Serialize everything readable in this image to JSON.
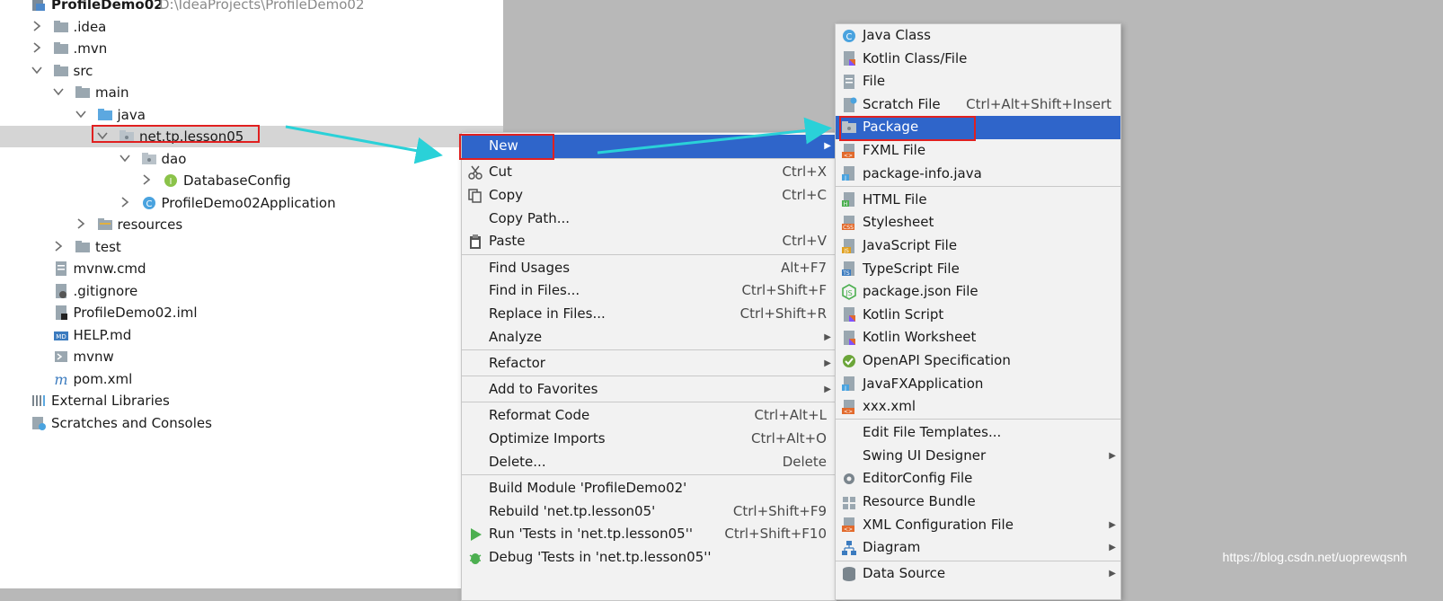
{
  "tree": {
    "rows": [
      {
        "label": "ProfileDemo02",
        "hint": "D:\\IdeaProjects\\ProfileDemo02",
        "bold": true,
        "indent": 0,
        "icon": "module-icon",
        "chev": "none"
      },
      {
        "label": ".idea",
        "indent": 1,
        "icon": "folder-icon",
        "chev": "right"
      },
      {
        "label": ".mvn",
        "indent": 1,
        "icon": "folder-icon",
        "chev": "right"
      },
      {
        "label": "src",
        "indent": 1,
        "icon": "folder-icon",
        "chev": "down"
      },
      {
        "label": "main",
        "indent": 2,
        "icon": "folder-icon",
        "chev": "down"
      },
      {
        "label": "java",
        "indent": 3,
        "icon": "source-folder-icon",
        "chev": "down"
      },
      {
        "label": "net.tp.lesson05",
        "indent": 4,
        "icon": "package-icon",
        "chev": "down",
        "selected": true
      },
      {
        "label": "dao",
        "indent": 5,
        "icon": "package-icon",
        "chev": "down"
      },
      {
        "label": "DatabaseConfig",
        "indent": 6,
        "icon": "interface-icon",
        "chev": "right"
      },
      {
        "label": "ProfileDemo02Application",
        "indent": 5,
        "icon": "spring-class-icon",
        "chev": "right"
      },
      {
        "label": "resources",
        "indent": 3,
        "icon": "resources-folder-icon",
        "chev": "right"
      },
      {
        "label": "test",
        "indent": 2,
        "icon": "folder-icon",
        "chev": "right"
      },
      {
        "label": "mvnw.cmd",
        "indent": 1,
        "icon": "text-file-icon",
        "chev": "none"
      },
      {
        "label": ".gitignore",
        "indent": 1,
        "icon": "ignore-file-icon",
        "chev": "none"
      },
      {
        "label": "ProfileDemo02.iml",
        "indent": 1,
        "icon": "iml-file-icon",
        "chev": "none"
      },
      {
        "label": "HELP.md",
        "indent": 1,
        "icon": "markdown-icon",
        "chev": "none"
      },
      {
        "label": "mvnw",
        "indent": 1,
        "icon": "shell-script-icon",
        "chev": "none"
      },
      {
        "label": "pom.xml",
        "indent": 1,
        "icon": "maven-icon",
        "chev": "none"
      },
      {
        "label": "External Libraries",
        "indent": 0,
        "icon": "libraries-icon",
        "chev": "none"
      },
      {
        "label": "Scratches and Consoles",
        "indent": 0,
        "icon": "scratches-icon",
        "chev": "none"
      }
    ]
  },
  "context_menu": {
    "items": [
      {
        "label": "New",
        "shortcut": "",
        "submenu": true,
        "highlighted": true,
        "icon": ""
      },
      {
        "sep": true
      },
      {
        "label": "Cut",
        "shortcut": "Ctrl+X",
        "icon": "cut-icon"
      },
      {
        "label": "Copy",
        "shortcut": "Ctrl+C",
        "icon": "copy-icon"
      },
      {
        "label": "Copy Path...",
        "shortcut": "",
        "icon": ""
      },
      {
        "label": "Paste",
        "shortcut": "Ctrl+V",
        "icon": "paste-icon"
      },
      {
        "sep": true
      },
      {
        "label": "Find Usages",
        "shortcut": "Alt+F7",
        "icon": ""
      },
      {
        "label": "Find in Files...",
        "shortcut": "Ctrl+Shift+F",
        "icon": ""
      },
      {
        "label": "Replace in Files...",
        "shortcut": "Ctrl+Shift+R",
        "icon": ""
      },
      {
        "label": "Analyze",
        "shortcut": "",
        "submenu": true,
        "icon": ""
      },
      {
        "sep": true
      },
      {
        "label": "Refactor",
        "shortcut": "",
        "submenu": true,
        "icon": ""
      },
      {
        "sep": true
      },
      {
        "label": "Add to Favorites",
        "shortcut": "",
        "submenu": true,
        "icon": ""
      },
      {
        "sep": true
      },
      {
        "label": "Reformat Code",
        "shortcut": "Ctrl+Alt+L",
        "icon": ""
      },
      {
        "label": "Optimize Imports",
        "shortcut": "Ctrl+Alt+O",
        "icon": ""
      },
      {
        "label": "Delete...",
        "shortcut": "Delete",
        "icon": ""
      },
      {
        "sep": true
      },
      {
        "label": "Build Module 'ProfileDemo02'",
        "shortcut": "",
        "icon": ""
      },
      {
        "label": "Rebuild 'net.tp.lesson05'",
        "shortcut": "Ctrl+Shift+F9",
        "icon": ""
      },
      {
        "label": "Run 'Tests in 'net.tp.lesson05''",
        "shortcut": "Ctrl+Shift+F10",
        "icon": "run-icon"
      },
      {
        "label": "Debug 'Tests in 'net.tp.lesson05''",
        "shortcut": "",
        "icon": "debug-icon"
      }
    ]
  },
  "new_submenu": {
    "items": [
      {
        "label": "Java Class",
        "shortcut": "",
        "icon": "java-class-icon"
      },
      {
        "label": "Kotlin Class/File",
        "shortcut": "",
        "icon": "kotlin-file-icon"
      },
      {
        "label": "File",
        "shortcut": "",
        "icon": "file-icon"
      },
      {
        "label": "Scratch File",
        "shortcut": "Ctrl+Alt+Shift+Insert",
        "icon": "scratch-file-icon"
      },
      {
        "label": "Package",
        "shortcut": "",
        "icon": "package-icon",
        "highlighted": true
      },
      {
        "label": "FXML File",
        "shortcut": "",
        "icon": "fxml-file-icon"
      },
      {
        "label": "package-info.java",
        "shortcut": "",
        "icon": "java-file-icon"
      },
      {
        "sep": true
      },
      {
        "label": "HTML File",
        "shortcut": "",
        "icon": "html-file-icon"
      },
      {
        "label": "Stylesheet",
        "shortcut": "",
        "icon": "css-file-icon"
      },
      {
        "label": "JavaScript File",
        "shortcut": "",
        "icon": "js-file-icon"
      },
      {
        "label": "TypeScript File",
        "shortcut": "",
        "icon": "ts-file-icon"
      },
      {
        "label": "package.json File",
        "shortcut": "",
        "icon": "nodejs-icon"
      },
      {
        "label": "Kotlin Script",
        "shortcut": "",
        "icon": "kotlin-file-icon"
      },
      {
        "label": "Kotlin Worksheet",
        "shortcut": "",
        "icon": "kotlin-file-icon"
      },
      {
        "label": "OpenAPI Specification",
        "shortcut": "",
        "icon": "openapi-icon"
      },
      {
        "label": "JavaFXApplication",
        "shortcut": "",
        "icon": "java-file-icon"
      },
      {
        "label": "xxx.xml",
        "shortcut": "",
        "icon": "xml-file-icon"
      },
      {
        "sep": true
      },
      {
        "label": "Edit File Templates...",
        "shortcut": "",
        "icon": ""
      },
      {
        "label": "Swing UI Designer",
        "shortcut": "",
        "submenu": true,
        "icon": ""
      },
      {
        "label": "EditorConfig File",
        "shortcut": "",
        "icon": "gear-icon"
      },
      {
        "label": "Resource Bundle",
        "shortcut": "",
        "icon": "resource-bundle-icon"
      },
      {
        "label": "XML Configuration File",
        "shortcut": "",
        "submenu": true,
        "icon": "xml-file-icon"
      },
      {
        "label": "Diagram",
        "shortcut": "",
        "submenu": true,
        "icon": "diagram-icon"
      },
      {
        "sep": true
      },
      {
        "label": "Data Source",
        "shortcut": "",
        "submenu": true,
        "icon": "database-icon"
      }
    ]
  },
  "watermark": "https://blog.csdn.net/uoprewqsnh",
  "colors": {
    "highlight": "#2f65ca",
    "annotation_red": "#e02020",
    "annotation_arrow": "#2ad1d8"
  }
}
